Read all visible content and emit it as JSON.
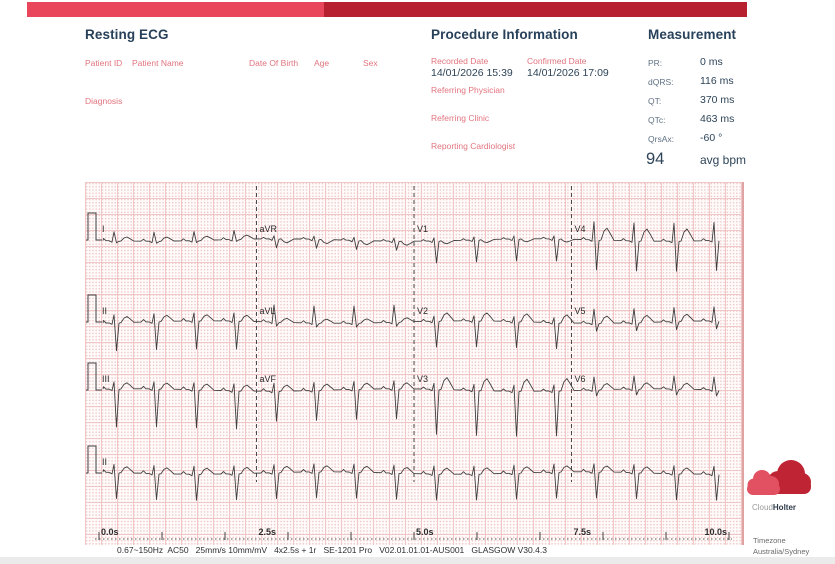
{
  "header": {
    "title": "Resting ECG"
  },
  "patient": {
    "fields": [
      "Patient ID",
      "Patient Name",
      "Date Of Birth",
      "Age",
      "Sex"
    ],
    "diagnosis_label": "Diagnosis"
  },
  "procedure": {
    "title": "Procedure Information",
    "recorded_date_label": "Recorded Date",
    "recorded_date_value": "14/01/2026 15:39",
    "confirmed_date_label": "Confirmed Date",
    "confirmed_date_value": "14/01/2026 17:09",
    "referring_physician_label": "Referring Physician",
    "referring_clinic_label": "Referring Clinic",
    "reporting_cardiologist_label": "Reporting Cardiologist"
  },
  "measurement": {
    "title": "Measurement",
    "rows": [
      {
        "label": "PR:",
        "value": "0 ms"
      },
      {
        "label": "dQRS:",
        "value": "116 ms"
      },
      {
        "label": "QT:",
        "value": "370 ms"
      },
      {
        "label": "QTc:",
        "value": "463 ms"
      },
      {
        "label": "QrsAx:",
        "value": "-60 °"
      }
    ],
    "heart_rate": "94",
    "heart_rate_unit": "avg bpm"
  },
  "ecg": {
    "speed": "25mm/s",
    "gain": "10mm/mV",
    "duration_s": 10,
    "avg_bpm": 94,
    "time_labels": [
      "0.0s",
      "2.5s",
      "5.0s",
      "7.5s",
      "10.0s"
    ],
    "settings_line": "0.67~150Hz  AC50   25mm/s 10mm/mV   4x2.5s + 1r   SE-1201 Pro   V02.01.01.01-AUS001   GLASGOW V30.4.3",
    "rows": [
      {
        "leads": [
          {
            "name": "I",
            "amps": {
              "p": 2,
              "r": 9,
              "s": 2,
              "t": 4
            }
          },
          {
            "name": "aVR",
            "amps": {
              "p": 1.5,
              "r": 3,
              "s": 9,
              "t": -4
            }
          },
          {
            "name": "V1",
            "amps": {
              "p": 1.5,
              "r": 3,
              "s": 22,
              "t": -3
            }
          },
          {
            "name": "V4",
            "amps": {
              "p": 2,
              "r": 18,
              "s": 30,
              "t": 12
            }
          }
        ]
      },
      {
        "leads": [
          {
            "name": "II",
            "amps": {
              "p": 2.5,
              "r": 8,
              "s": 28,
              "t": 6
            }
          },
          {
            "name": "aVL",
            "amps": {
              "p": 2,
              "r": 17,
              "s": 4,
              "t": 4
            }
          },
          {
            "name": "V2",
            "amps": {
              "p": 2,
              "r": 5,
              "s": 26,
              "t": 8
            }
          },
          {
            "name": "V5",
            "amps": {
              "p": 2,
              "r": 14,
              "s": 8,
              "t": 7
            }
          }
        ]
      },
      {
        "leads": [
          {
            "name": "III",
            "amps": {
              "p": 2.5,
              "r": 7,
              "s": 38,
              "t": 6
            }
          },
          {
            "name": "aVF",
            "amps": {
              "p": 2.5,
              "r": 8,
              "s": 30,
              "t": 6
            }
          },
          {
            "name": "V3",
            "amps": {
              "p": 2,
              "r": 6,
              "s": 45,
              "t": 12
            }
          },
          {
            "name": "V6",
            "amps": {
              "p": 2,
              "r": 13,
              "s": 6,
              "t": 6
            }
          }
        ]
      },
      {
        "leads": [
          {
            "name": "II",
            "amps": {
              "p": 2.5,
              "r": 8,
              "s": 26,
              "t": 6
            }
          }
        ]
      }
    ]
  },
  "branding": {
    "logo_cloud": "Cloud",
    "logo_holter": "Holter",
    "timezone_label": "Timezone",
    "timezone_value": "Australia/Sydney"
  },
  "colors": {
    "topbar_left": "#e9465b",
    "topbar_right": "#b7202e",
    "accent_text": "#e2747e",
    "heading": "#28415a",
    "trace": "#3f3f3f",
    "grid_line": "#f0c6c6"
  }
}
